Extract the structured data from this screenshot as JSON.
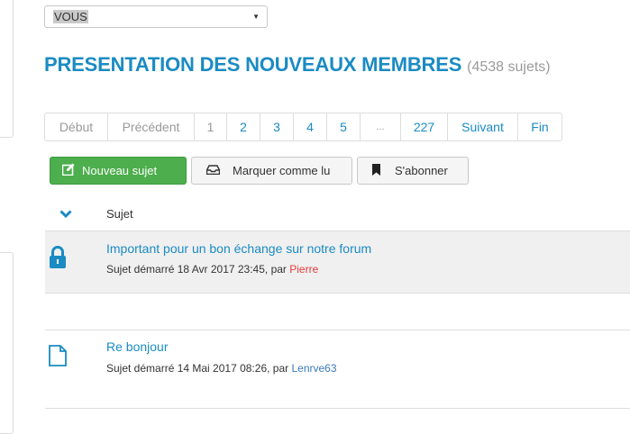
{
  "filter_select": {
    "value": "VOUS"
  },
  "forum": {
    "title": "PRESENTATION DES NOUVEAUX MEMBRES",
    "count": "(4538 sujets)"
  },
  "pagination": {
    "first": "Début",
    "prev": "Précédent",
    "pages": [
      "1",
      "2",
      "3",
      "4",
      "5",
      "...",
      "227"
    ],
    "next": "Suivant",
    "last": "Fin"
  },
  "actions": {
    "new_topic": "Nouveau sujet",
    "mark_read": "Marquer comme lu",
    "subscribe": "S'abonner"
  },
  "list_header": {
    "subject": "Sujet"
  },
  "topics": [
    {
      "title": "Important pour un bon échange sur notre forum",
      "meta": "Sujet démarré 18 Avr 2017 23:45, par ",
      "author": "Pierre",
      "icon": "lock-icon"
    },
    {
      "title": "Re bonjour",
      "meta": "Sujet démarré 14 Mai 2017 08:26, par ",
      "author": "Lenrve63",
      "icon": "document-icon"
    }
  ],
  "colors": {
    "accent": "#1a8bc3",
    "button_green": "#4cae4c",
    "author_red": "#e83a3a",
    "author_blue": "#3a7ab8"
  }
}
